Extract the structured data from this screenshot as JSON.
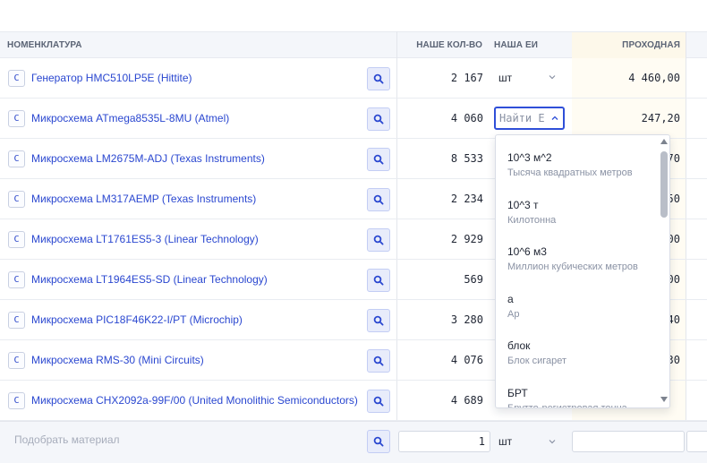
{
  "columns": {
    "nomenclature": "НОМЕНКЛАТУРА",
    "our_qty": "НАШЕ КОЛ-ВО",
    "our_unit": "НАША ЕИ",
    "pass_price": "ПРОХОДНАЯ"
  },
  "rows": [
    {
      "badge": "C",
      "name": "Генератор HMC510LP5E (Hittite)",
      "qty": "2 167",
      "unit": "шт",
      "price": "4 460,00"
    },
    {
      "badge": "C",
      "name": "Микросхема ATmega8535L-8MU (Atmel)",
      "qty": "4 060",
      "unit": "",
      "price": "247,20"
    },
    {
      "badge": "C",
      "name": "Микросхема LM2675M-ADJ (Texas Instruments)",
      "qty": "8 533",
      "unit": "",
      "price": "70"
    },
    {
      "badge": "C",
      "name": "Микросхема LM317AEMP (Texas Instruments)",
      "qty": "2 234",
      "unit": "",
      "price": "50"
    },
    {
      "badge": "C",
      "name": "Микросхема LT1761ES5-3 (Linear Technology)",
      "qty": "2 929",
      "unit": "",
      "price": "00"
    },
    {
      "badge": "C",
      "name": "Микросхема LT1964ES5-SD (Linear Technology)",
      "qty": "569",
      "unit": "",
      "price": "00"
    },
    {
      "badge": "C",
      "name": "Микросхема PIC18F46K22-I/PT (Microchip)",
      "qty": "3 280",
      "unit": "",
      "price": "40"
    },
    {
      "badge": "C",
      "name": "Микросхема RMS-30 (Mini Circuits)",
      "qty": "4 076",
      "unit": "",
      "price": "30"
    },
    {
      "badge": "C",
      "name": "Микросхема CHX2092a-99F/00 (United Monolithic Semiconductors)",
      "qty": "4 689",
      "unit": "",
      "price": ""
    }
  ],
  "unit_search": {
    "placeholder": "Найти Е"
  },
  "dropdown": {
    "options": [
      {
        "code": "10^3 м^2",
        "desc": "Тысяча квадратных метров"
      },
      {
        "code": "10^3 т",
        "desc": "Килотонна"
      },
      {
        "code": "10^6 м3",
        "desc": "Миллион кубических метров"
      },
      {
        "code": "а",
        "desc": "Ар"
      },
      {
        "code": "блок",
        "desc": "Блок сигарет"
      },
      {
        "code": "БРТ",
        "desc": "Брутто-регистровая тонна"
      }
    ]
  },
  "footer": {
    "material_placeholder": "Подобрать материал",
    "qty_value": "1",
    "unit_value": "шт"
  },
  "icons": {
    "search": "search-icon",
    "chevron_down": "chevron-down-icon",
    "chevron_up": "chevron-up-icon"
  },
  "colors": {
    "link": "#2a47d0",
    "accent": "#2f4fd8",
    "header_bg": "#f4f6fa",
    "price_col_bg": "#fffcf3"
  }
}
